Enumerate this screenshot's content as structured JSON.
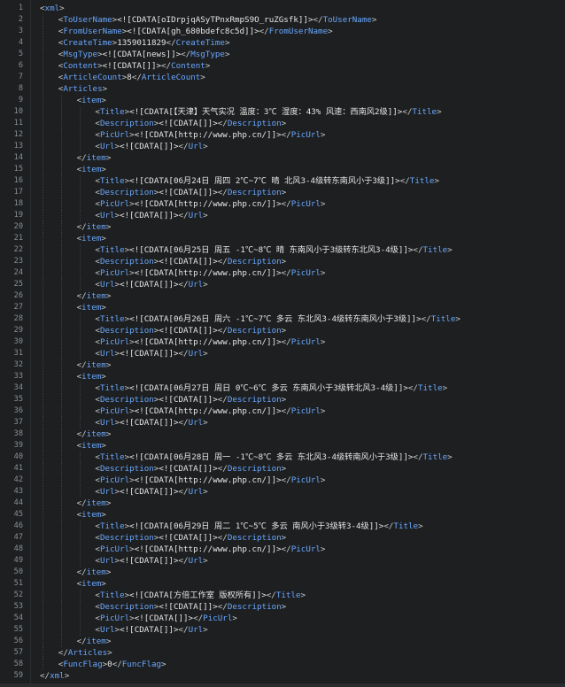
{
  "editor": {
    "lines": [
      {
        "n": "1",
        "indent": 0,
        "t": "open",
        "tag": "xml"
      },
      {
        "n": "2",
        "indent": 1,
        "t": "el",
        "tag": "ToUserName",
        "val": "<![CDATA[oIDrpjqASyTPnxRmpS9O_ruZGsfk]]>"
      },
      {
        "n": "3",
        "indent": 1,
        "t": "el",
        "tag": "FromUserName",
        "val": "<![CDATA[gh_680bdefc8c5d]]>"
      },
      {
        "n": "4",
        "indent": 1,
        "t": "el",
        "tag": "CreateTime",
        "val": "1359011829"
      },
      {
        "n": "5",
        "indent": 1,
        "t": "el",
        "tag": "MsgType",
        "val": "<![CDATA[news]]>"
      },
      {
        "n": "6",
        "indent": 1,
        "t": "el",
        "tag": "Content",
        "val": "<![CDATA[]]>"
      },
      {
        "n": "7",
        "indent": 1,
        "t": "el",
        "tag": "ArticleCount",
        "val": "8"
      },
      {
        "n": "8",
        "indent": 1,
        "t": "open",
        "tag": "Articles"
      },
      {
        "n": "9",
        "indent": 2,
        "t": "open",
        "tag": "item"
      },
      {
        "n": "10",
        "indent": 3,
        "t": "el",
        "tag": "Title",
        "val": "<![CDATA[【天津】天气实况 温度：3℃ 湿度：43% 风速：西南风2级]]>"
      },
      {
        "n": "11",
        "indent": 3,
        "t": "el",
        "tag": "Description",
        "val": "<![CDATA[]]>"
      },
      {
        "n": "12",
        "indent": 3,
        "t": "el",
        "tag": "PicUrl",
        "val": "<![CDATA[http://www.php.cn/]]>"
      },
      {
        "n": "13",
        "indent": 3,
        "t": "el",
        "tag": "Url",
        "val": "<![CDATA[]]>"
      },
      {
        "n": "14",
        "indent": 2,
        "t": "close",
        "tag": "item"
      },
      {
        "n": "15",
        "indent": 2,
        "t": "open",
        "tag": "item"
      },
      {
        "n": "16",
        "indent": 3,
        "t": "el",
        "tag": "Title",
        "val": "<![CDATA[06月24日 周四 2℃~7℃ 晴 北风3-4级转东南风小于3级]]>"
      },
      {
        "n": "17",
        "indent": 3,
        "t": "el",
        "tag": "Description",
        "val": "<![CDATA[]]>"
      },
      {
        "n": "18",
        "indent": 3,
        "t": "el",
        "tag": "PicUrl",
        "val": "<![CDATA[http://www.php.cn/]]>"
      },
      {
        "n": "19",
        "indent": 3,
        "t": "el",
        "tag": "Url",
        "val": "<![CDATA[]]>"
      },
      {
        "n": "20",
        "indent": 2,
        "t": "close",
        "tag": "item"
      },
      {
        "n": "21",
        "indent": 2,
        "t": "open",
        "tag": "item"
      },
      {
        "n": "22",
        "indent": 3,
        "t": "el",
        "tag": "Title",
        "val": "<![CDATA[06月25日 周五 -1℃~8℃ 晴 东南风小于3级转东北风3-4级]]>"
      },
      {
        "n": "23",
        "indent": 3,
        "t": "el",
        "tag": "Description",
        "val": "<![CDATA[]]>"
      },
      {
        "n": "24",
        "indent": 3,
        "t": "el",
        "tag": "PicUrl",
        "val": "<![CDATA[http://www.php.cn/]]>"
      },
      {
        "n": "25",
        "indent": 3,
        "t": "el",
        "tag": "Url",
        "val": "<![CDATA[]]>"
      },
      {
        "n": "26",
        "indent": 2,
        "t": "close",
        "tag": "item"
      },
      {
        "n": "27",
        "indent": 2,
        "t": "open",
        "tag": "item"
      },
      {
        "n": "28",
        "indent": 3,
        "t": "el",
        "tag": "Title",
        "val": "<![CDATA[06月26日 周六 -1℃~7℃ 多云 东北风3-4级转东南风小于3级]]>"
      },
      {
        "n": "29",
        "indent": 3,
        "t": "el",
        "tag": "Description",
        "val": "<![CDATA[]]>"
      },
      {
        "n": "30",
        "indent": 3,
        "t": "el",
        "tag": "PicUrl",
        "val": "<![CDATA[http://www.php.cn/]]>"
      },
      {
        "n": "31",
        "indent": 3,
        "t": "el",
        "tag": "Url",
        "val": "<![CDATA[]]>"
      },
      {
        "n": "32",
        "indent": 2,
        "t": "close",
        "tag": "item"
      },
      {
        "n": "33",
        "indent": 2,
        "t": "open",
        "tag": "item"
      },
      {
        "n": "34",
        "indent": 3,
        "t": "el",
        "tag": "Title",
        "val": "<![CDATA[06月27日 周日 0℃~6℃ 多云 东南风小于3级转北风3-4级]]>"
      },
      {
        "n": "35",
        "indent": 3,
        "t": "el",
        "tag": "Description",
        "val": "<![CDATA[]]>"
      },
      {
        "n": "36",
        "indent": 3,
        "t": "el",
        "tag": "PicUrl",
        "val": "<![CDATA[http://www.php.cn/]]>"
      },
      {
        "n": "37",
        "indent": 3,
        "t": "el",
        "tag": "Url",
        "val": "<![CDATA[]]>"
      },
      {
        "n": "38",
        "indent": 2,
        "t": "close",
        "tag": "item"
      },
      {
        "n": "39",
        "indent": 2,
        "t": "open",
        "tag": "item"
      },
      {
        "n": "40",
        "indent": 3,
        "t": "el",
        "tag": "Title",
        "val": "<![CDATA[06月28日 周一 -1℃~8℃ 多云 东北风3-4级转南风小于3级]]>"
      },
      {
        "n": "41",
        "indent": 3,
        "t": "el",
        "tag": "Description",
        "val": "<![CDATA[]]>"
      },
      {
        "n": "42",
        "indent": 3,
        "t": "el",
        "tag": "PicUrl",
        "val": "<![CDATA[http://www.php.cn/]]>"
      },
      {
        "n": "43",
        "indent": 3,
        "t": "el",
        "tag": "Url",
        "val": "<![CDATA[]]>"
      },
      {
        "n": "44",
        "indent": 2,
        "t": "close",
        "tag": "item"
      },
      {
        "n": "45",
        "indent": 2,
        "t": "open",
        "tag": "item"
      },
      {
        "n": "46",
        "indent": 3,
        "t": "el",
        "tag": "Title",
        "val": "<![CDATA[06月29日 周二 1℃~5℃ 多云 南风小于3级转3-4级]]>"
      },
      {
        "n": "47",
        "indent": 3,
        "t": "el",
        "tag": "Description",
        "val": "<![CDATA[]]>"
      },
      {
        "n": "48",
        "indent": 3,
        "t": "el",
        "tag": "PicUrl",
        "val": "<![CDATA[http://www.php.cn/]]>"
      },
      {
        "n": "49",
        "indent": 3,
        "t": "el",
        "tag": "Url",
        "val": "<![CDATA[]]>"
      },
      {
        "n": "50",
        "indent": 2,
        "t": "close",
        "tag": "item"
      },
      {
        "n": "51",
        "indent": 2,
        "t": "open",
        "tag": "item"
      },
      {
        "n": "52",
        "indent": 3,
        "t": "el",
        "tag": "Title",
        "val": "<![CDATA[方倍工作室 版权所有]]>"
      },
      {
        "n": "53",
        "indent": 3,
        "t": "el",
        "tag": "Description",
        "val": "<![CDATA[]]>"
      },
      {
        "n": "54",
        "indent": 3,
        "t": "el",
        "tag": "PicUrl",
        "val": "<![CDATA[]]>"
      },
      {
        "n": "55",
        "indent": 3,
        "t": "el",
        "tag": "Url",
        "val": "<![CDATA[]]>"
      },
      {
        "n": "56",
        "indent": 2,
        "t": "close",
        "tag": "item"
      },
      {
        "n": "57",
        "indent": 1,
        "t": "close",
        "tag": "Articles"
      },
      {
        "n": "58",
        "indent": 1,
        "t": "el",
        "tag": "FuncFlag",
        "val": "0"
      },
      {
        "n": "59",
        "indent": 0,
        "t": "close",
        "tag": "xml"
      }
    ]
  }
}
